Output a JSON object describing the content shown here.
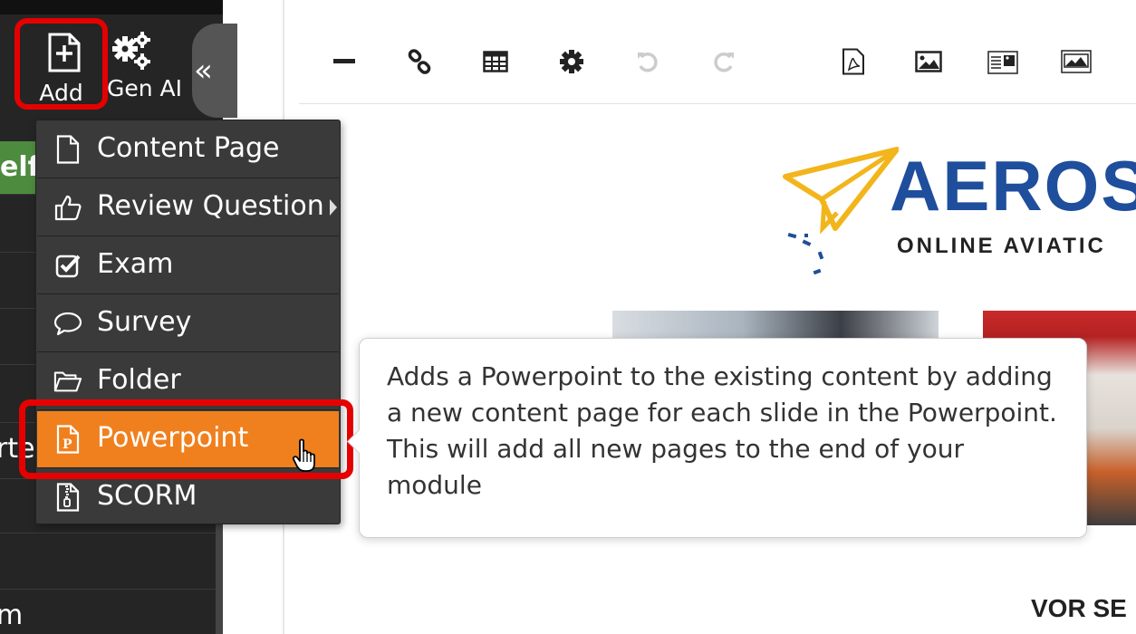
{
  "sidebar": {
    "add_label": "Add",
    "genai_label": "Gen AI",
    "collapse_glyph": "«",
    "fragments": {
      "green": "elf",
      "row_a": "rte",
      "row_b": "m"
    }
  },
  "toolbar": {
    "icons": [
      "horizontal-rule-icon",
      "link-icon",
      "table-icon",
      "gear-icon",
      "undo-icon",
      "redo-icon",
      "pdf-file-icon",
      "image-icon",
      "image-with-text-icon",
      "image-gallery-icon"
    ]
  },
  "logo": {
    "word": "AEROS",
    "tagline": "ONLINE AVIATIC"
  },
  "footer_text": "VOR SE",
  "menu": {
    "items": [
      {
        "label": "Content Page",
        "icon": "file-icon"
      },
      {
        "label": "Review Question",
        "icon": "thumbs-up-icon",
        "submenu": true
      },
      {
        "label": "Exam",
        "icon": "checkbox-icon"
      },
      {
        "label": "Survey",
        "icon": "comment-icon"
      },
      {
        "label": "Folder",
        "icon": "folder-open-icon"
      },
      {
        "label": "Powerpoint",
        "icon": "powerpoint-file-icon",
        "active": true
      },
      {
        "label": "SCORM",
        "icon": "zip-file-icon"
      }
    ]
  },
  "tooltip": {
    "text": "Adds a Powerpoint to the existing content by adding a new content page for each slide in the Powerpoint. This will add all new pages to the end of your module"
  },
  "colors": {
    "sidebar_bg": "#252525",
    "menu_bg": "#3a3a3a",
    "menu_active": "#f0801e",
    "highlight_red": "#e60000",
    "logo_blue": "#1f4e9c",
    "logo_yellow": "#f2b51c",
    "green_badge": "#4d8c3f"
  }
}
